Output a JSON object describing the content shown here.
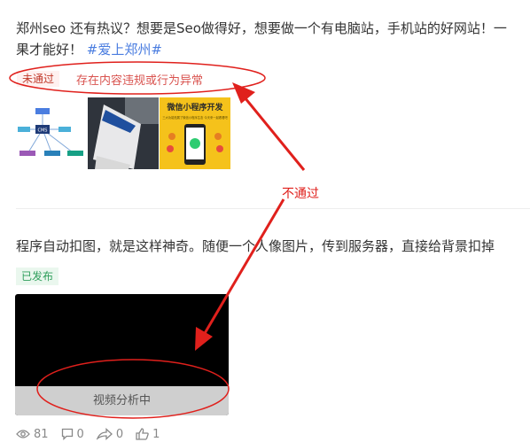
{
  "post1": {
    "text_line1": "郑州seo 还有热议？想要是Seo做得好，想要做一个有电脑站，手机站的好网站！一",
    "text_line2_prefix": "果才能好！",
    "hashtag": "#爱上郑州#",
    "status_badge": "未通过",
    "status_reason": "存在内容违规或行为异常",
    "images": [
      {
        "name": "diagram-thumbnail",
        "center_label": "CMS"
      },
      {
        "name": "photo-thumbnail"
      },
      {
        "name": "promo-thumbnail",
        "title": "微信小程序开发",
        "subtitle": "三大功能拓展了微信小程序生态 今天来一起看看吧"
      }
    ]
  },
  "post2": {
    "text": "程序自动扣图，就是这样神奇。随便一个人像图片，传到服务器，直接给背景扣掉",
    "status_badge": "已发布",
    "video_status": "视频分析中"
  },
  "stats": {
    "views": "81",
    "comments": "0",
    "shares": "0",
    "likes": "1"
  },
  "annotation": {
    "label": "不通过",
    "color": "#e0201c"
  }
}
